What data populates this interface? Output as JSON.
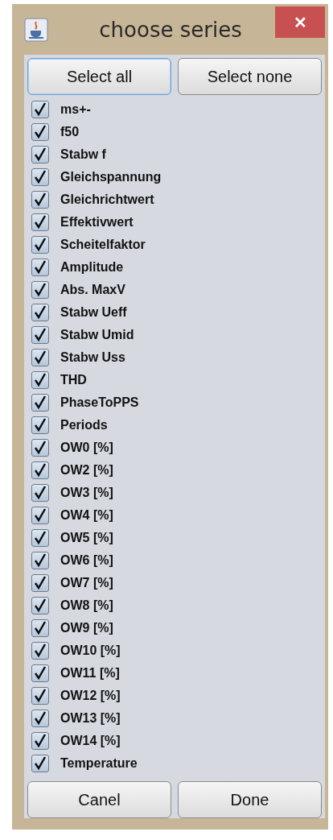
{
  "window": {
    "title": "choose series",
    "close": "✕"
  },
  "top_buttons": [
    {
      "label": "Select all",
      "focused": true
    },
    {
      "label": "Select none",
      "focused": false
    }
  ],
  "series": [
    {
      "label": "ms+-",
      "checked": true
    },
    {
      "label": "f50",
      "checked": true
    },
    {
      "label": "Stabw f",
      "checked": true
    },
    {
      "label": "Gleichspannung",
      "checked": true
    },
    {
      "label": "Gleichrichtwert",
      "checked": true
    },
    {
      "label": "Effektivwert",
      "checked": true
    },
    {
      "label": "Scheitelfaktor",
      "checked": true
    },
    {
      "label": "Amplitude",
      "checked": true
    },
    {
      "label": "Abs. MaxV",
      "checked": true
    },
    {
      "label": "Stabw Ueff",
      "checked": true
    },
    {
      "label": "Stabw Umid",
      "checked": true
    },
    {
      "label": "Stabw Uss",
      "checked": true
    },
    {
      "label": "THD",
      "checked": true
    },
    {
      "label": "PhaseToPPS",
      "checked": true
    },
    {
      "label": "Periods",
      "checked": true
    },
    {
      "label": "OW0 [%]",
      "checked": true
    },
    {
      "label": "OW2 [%]",
      "checked": true
    },
    {
      "label": "OW3 [%]",
      "checked": true
    },
    {
      "label": "OW4 [%]",
      "checked": true
    },
    {
      "label": "OW5 [%]",
      "checked": true
    },
    {
      "label": "OW6 [%]",
      "checked": true
    },
    {
      "label": "OW7 [%]",
      "checked": true
    },
    {
      "label": "OW8 [%]",
      "checked": true
    },
    {
      "label": "OW9 [%]",
      "checked": true
    },
    {
      "label": "OW10 [%]",
      "checked": true
    },
    {
      "label": "OW11 [%]",
      "checked": true
    },
    {
      "label": "OW12 [%]",
      "checked": true
    },
    {
      "label": "OW13 [%]",
      "checked": true
    },
    {
      "label": "OW14 [%]",
      "checked": true
    },
    {
      "label": "Temperature",
      "checked": true
    }
  ],
  "bottom_buttons": [
    {
      "label": "Canel",
      "focused": false
    },
    {
      "label": "Done",
      "focused": false
    }
  ]
}
